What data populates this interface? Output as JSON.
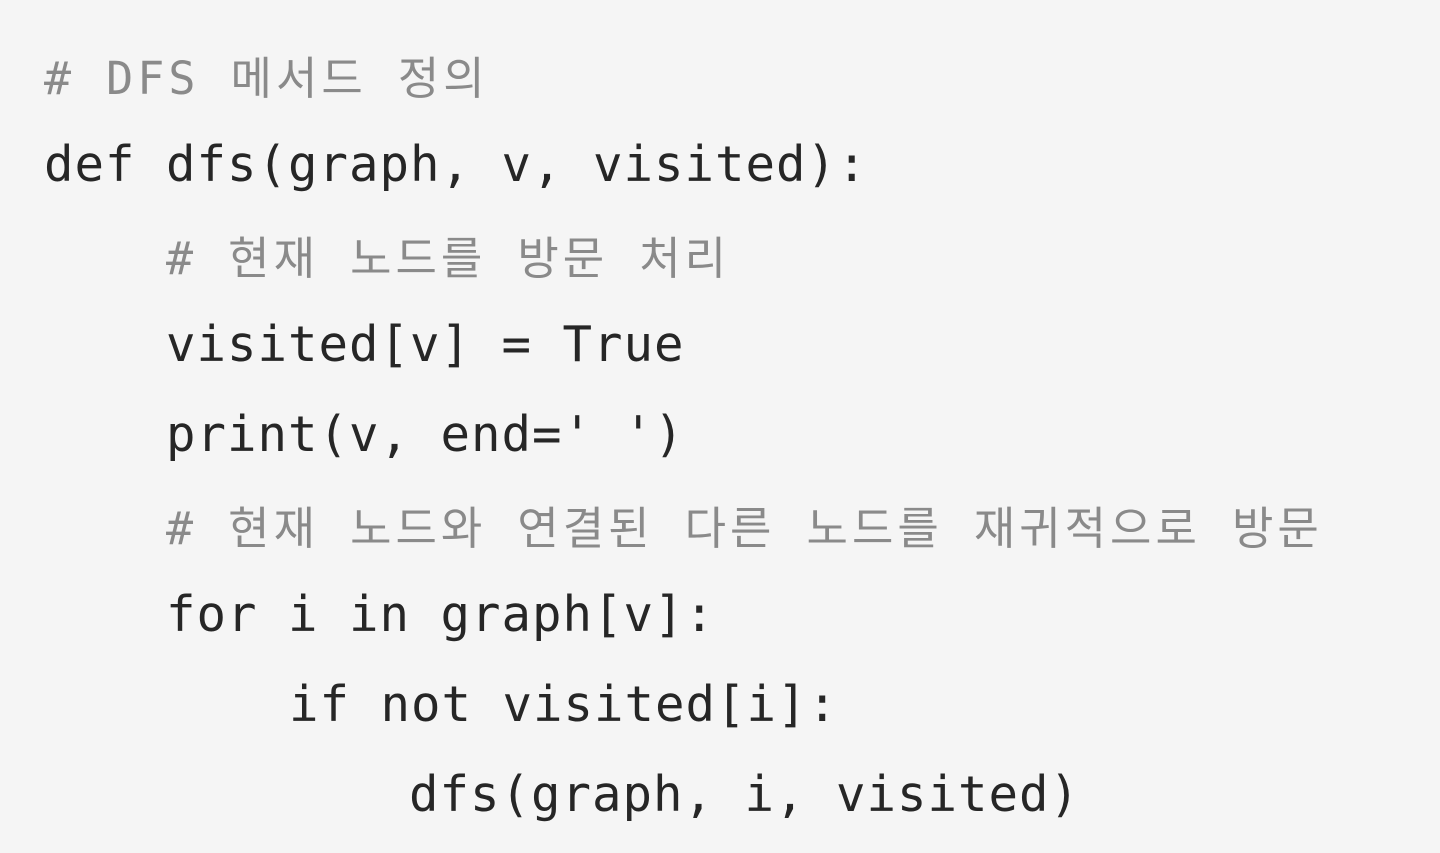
{
  "code": {
    "language": "python",
    "lines": [
      "# DFS 메서드 정의",
      "def dfs(graph, v, visited):",
      "# 현재 노드를 방문 처리",
      "visited[v] = True",
      "print(v, end=' ')",
      "# 현재 노드와 연결된 다른 노드를 재귀적으로 방문",
      "for i in graph[v]:",
      "if not visited[i]:",
      "dfs(graph, i, visited)"
    ]
  }
}
